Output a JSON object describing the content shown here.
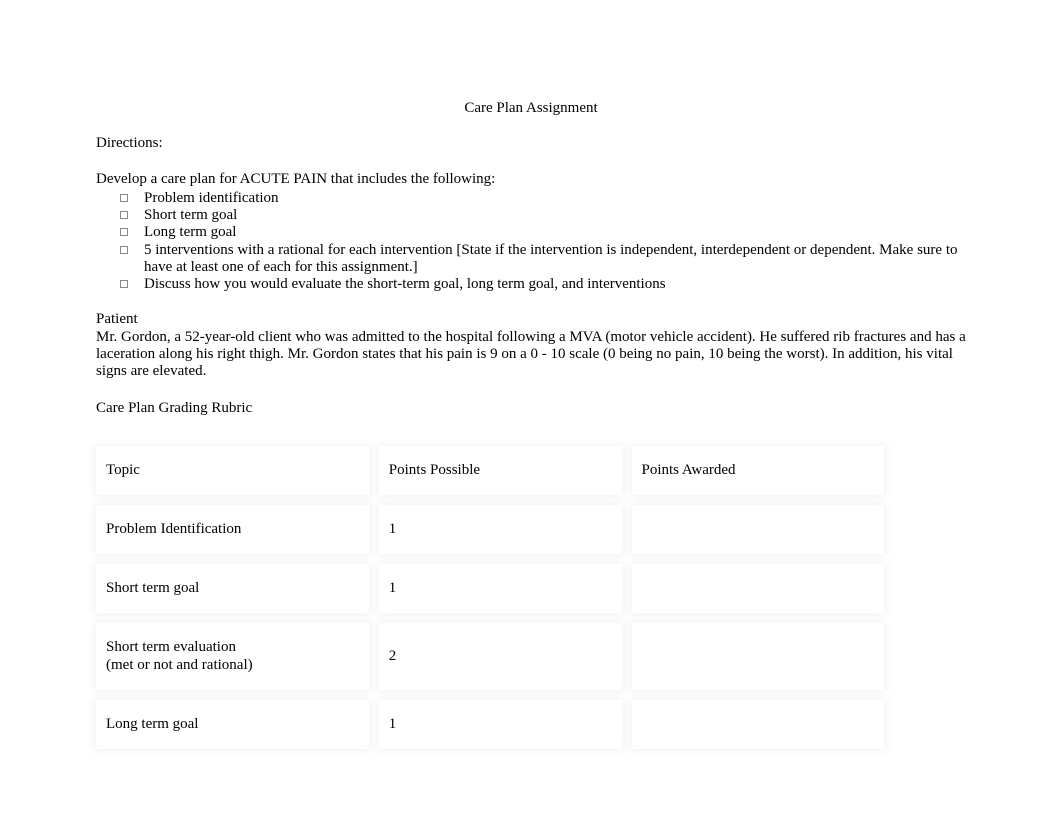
{
  "title": "Care Plan Assignment",
  "directions_label": "Directions:",
  "intro": "Develop a care plan for ACUTE PAIN that includes the following:",
  "bullets": [
    "Problem identification",
    "Short term goal",
    "Long term goal",
    "5 interventions with a rational for each intervention [State if the intervention is independent, interdependent or dependent. Make sure to have at least one of each for this assignment.]",
    "Discuss how you would evaluate the short-term goal, long term goal, and interventions"
  ],
  "patient_heading": "Patient",
  "patient_text": "Mr. Gordon, a 52-year-old client who was admitted to the hospital following a MVA (motor vehicle accident). He suffered rib fractures and has a laceration along his right thigh. Mr. Gordon states that his pain is 9 on a 0 - 10 scale (0 being no pain, 10 being the worst). In addition, his vital signs are elevated.",
  "rubric_label": "Care Plan Grading Rubric",
  "table": {
    "headers": {
      "topic": "Topic",
      "points_possible": "Points Possible",
      "points_awarded": "Points Awarded"
    },
    "rows": [
      {
        "topic": "Problem Identification",
        "points": "1",
        "awarded": ""
      },
      {
        "topic": "Short term goal",
        "points": "1",
        "awarded": ""
      },
      {
        "topic": "Short term evaluation\n(met or not and rational)",
        "points": "2",
        "awarded": ""
      },
      {
        "topic": "Long term goal",
        "points": "1",
        "awarded": ""
      }
    ]
  }
}
